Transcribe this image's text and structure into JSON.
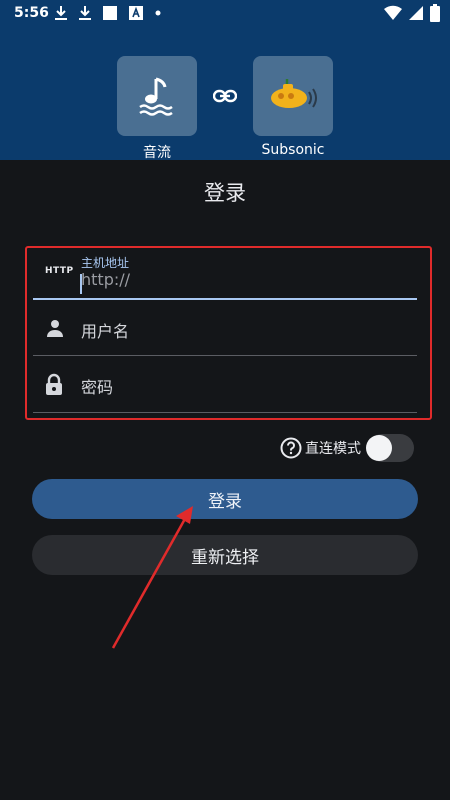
{
  "status_bar": {
    "time": "5:56",
    "left_icons": [
      "download-icon",
      "download-icon",
      "square-icon",
      "notification-a-icon",
      "dot-icon"
    ],
    "right_icons": [
      "wifi-icon",
      "signal-icon",
      "battery-icon"
    ]
  },
  "header": {
    "app_left": {
      "label": "音流",
      "icon": "music-note-waves-icon"
    },
    "link_icon": "link-icon",
    "app_right": {
      "label": "Subsonic",
      "icon": "submarine-logo-icon"
    }
  },
  "title": "登录",
  "form": {
    "host": {
      "prefix": "HTTP",
      "label": "主机地址",
      "value": "http://"
    },
    "username": {
      "placeholder": "用户名",
      "icon": "person-icon"
    },
    "password": {
      "placeholder": "密码",
      "icon": "lock-icon"
    }
  },
  "direct_mode": {
    "label": "直连模式",
    "help_icon": "help-circle-icon",
    "enabled": false
  },
  "buttons": {
    "login": "登录",
    "reselect": "重新选择"
  },
  "colors": {
    "header_bg": "#0b3b6c",
    "page_bg": "#141619",
    "accent": "#a9c8f2",
    "login_button": "#2e5b8f",
    "highlight_red": "#e02b2b"
  }
}
